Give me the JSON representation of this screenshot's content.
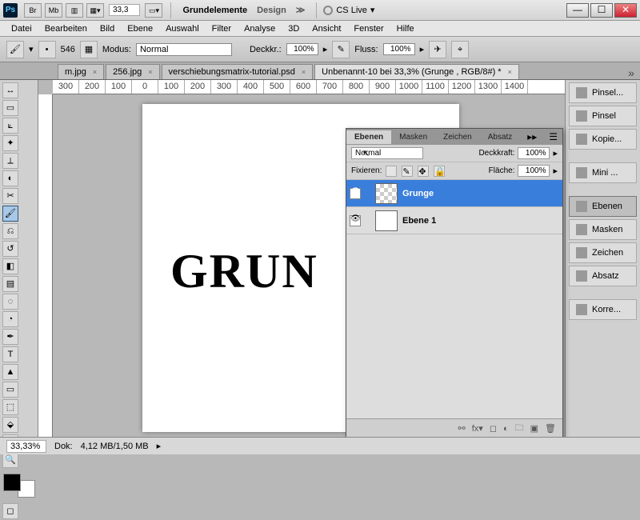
{
  "titlebar": {
    "zoom_dropdown": "33,3",
    "workspace_active": "Grundelemente",
    "workspace_other": "Design",
    "cslive": "CS Live"
  },
  "menu": [
    "Datei",
    "Bearbeiten",
    "Bild",
    "Ebene",
    "Auswahl",
    "Filter",
    "Analyse",
    "3D",
    "Ansicht",
    "Fenster",
    "Hilfe"
  ],
  "optbar": {
    "size": "546",
    "modus_label": "Modus:",
    "modus_value": "Normal",
    "deckkraft_label": "Deckkr.:",
    "deckkraft_value": "100%",
    "fluss_label": "Fluss:",
    "fluss_value": "100%"
  },
  "doc_tabs": [
    {
      "label": "m.jpg",
      "active": false
    },
    {
      "label": "256.jpg",
      "active": false
    },
    {
      "label": "verschiebungsmatrix-tutorial.psd",
      "active": false
    },
    {
      "label": "Unbenannt-10 bei 33,3% (Grunge , RGB/8#) *",
      "active": true
    }
  ],
  "ruler_marks": [
    "300",
    "200",
    "100",
    "0",
    "100",
    "200",
    "300",
    "400",
    "500",
    "600",
    "700",
    "800",
    "900",
    "1000",
    "1100",
    "1200",
    "1300",
    "1400"
  ],
  "canvas_text": "GRUN",
  "right_panels": [
    {
      "label": "Pinsel...",
      "active": false
    },
    {
      "label": "Pinsel",
      "active": false
    },
    {
      "label": "Kopie...",
      "active": false
    },
    {
      "label": "Mini ...",
      "active": false
    },
    {
      "label": "Ebenen",
      "active": true
    },
    {
      "label": "Masken",
      "active": false
    },
    {
      "label": "Zeichen",
      "active": false
    },
    {
      "label": "Absatz",
      "active": false
    },
    {
      "label": "Korre...",
      "active": false
    }
  ],
  "layers_panel": {
    "tabs": [
      "Ebenen",
      "Masken",
      "Zeichen",
      "Absatz"
    ],
    "blend_mode": "Normal",
    "deckkraft_label": "Deckkraft:",
    "deckkraft": "100%",
    "fix_label": "Fixieren:",
    "flaeche_label": "Fläche:",
    "flaeche": "100%",
    "layers": [
      {
        "name": "Grunge",
        "selected": true,
        "visible": true,
        "checker": true
      },
      {
        "name": "Ebene 1",
        "selected": false,
        "visible": true,
        "checker": false
      }
    ]
  },
  "status": {
    "zoom": "33,33%",
    "dok_label": "Dok:",
    "dok_value": "4,12 MB/1,50 MB"
  }
}
